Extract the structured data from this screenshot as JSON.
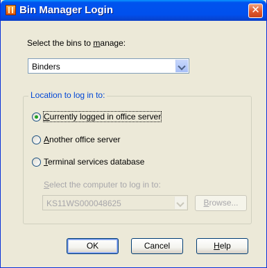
{
  "window": {
    "title": "Bin Manager Login",
    "close_glyph": "✕"
  },
  "bins": {
    "label_pre": "Select the bins to ",
    "label_accel": "m",
    "label_post": "anage:",
    "selected": "Binders"
  },
  "location": {
    "legend": "Location to log in to:",
    "options": [
      {
        "accel": "C",
        "rest": "urrently logged in office server",
        "checked": true
      },
      {
        "accel": "A",
        "rest": "nother office server",
        "checked": false
      },
      {
        "accel": "T",
        "rest": "erminal services database",
        "checked": false
      }
    ],
    "computer_label_pre": "",
    "computer_label_accel": "S",
    "computer_label_post": "elect the computer to log in to:",
    "computer_value": "KS11WS000048625",
    "browse_accel": "B",
    "browse_rest": "rowse..."
  },
  "buttons": {
    "ok": "OK",
    "cancel": "Cancel",
    "help_accel": "H",
    "help_rest": "elp"
  }
}
